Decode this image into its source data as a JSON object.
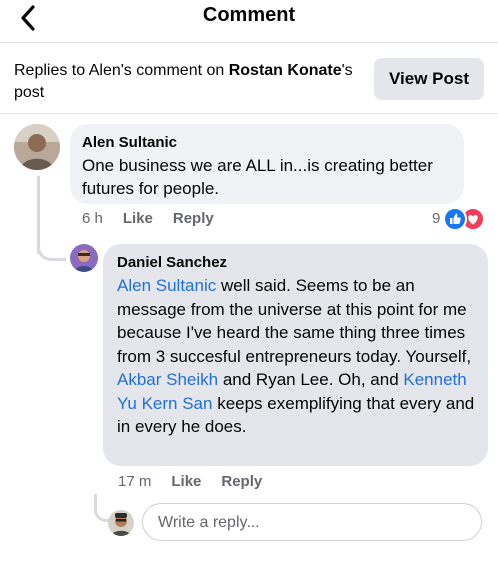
{
  "header": {
    "title": "Comment",
    "back_icon": "chevron-left-icon"
  },
  "context": {
    "prefix": "Replies to Alen's comment on ",
    "bold": "Rostan Konate",
    "suffix": "'s post",
    "view_post_label": "View Post"
  },
  "comment": {
    "author": "Alen Sultanic",
    "text": "One business we are ALL in...is creating better futures for people.",
    "time": "6 h",
    "like_label": "Like",
    "reply_label": "Reply",
    "reaction_count": "9",
    "reactions": [
      "like-icon",
      "love-icon"
    ]
  },
  "reply": {
    "author": "Daniel Sanchez",
    "mention1": "Alen Sultanic",
    "text1": " well said. Seems to be an message from the universe at this point for me because I've heard the same thing three times from 3 succesful entrepreneurs today. Yourself, ",
    "mention2": "Akbar Sheikh",
    "text2": " and Ryan Lee. Oh, and ",
    "mention3": "Kenneth Yu Kern San",
    "text3": " keeps exemplifying that every and in every he does.",
    "time": "17 m",
    "like_label": "Like",
    "reply_label": "Reply"
  },
  "composer": {
    "placeholder": "Write a reply..."
  },
  "colors": {
    "link": "#216fdb",
    "like": "#1877f2",
    "love": "#f33e58",
    "muted": "#65676b"
  }
}
